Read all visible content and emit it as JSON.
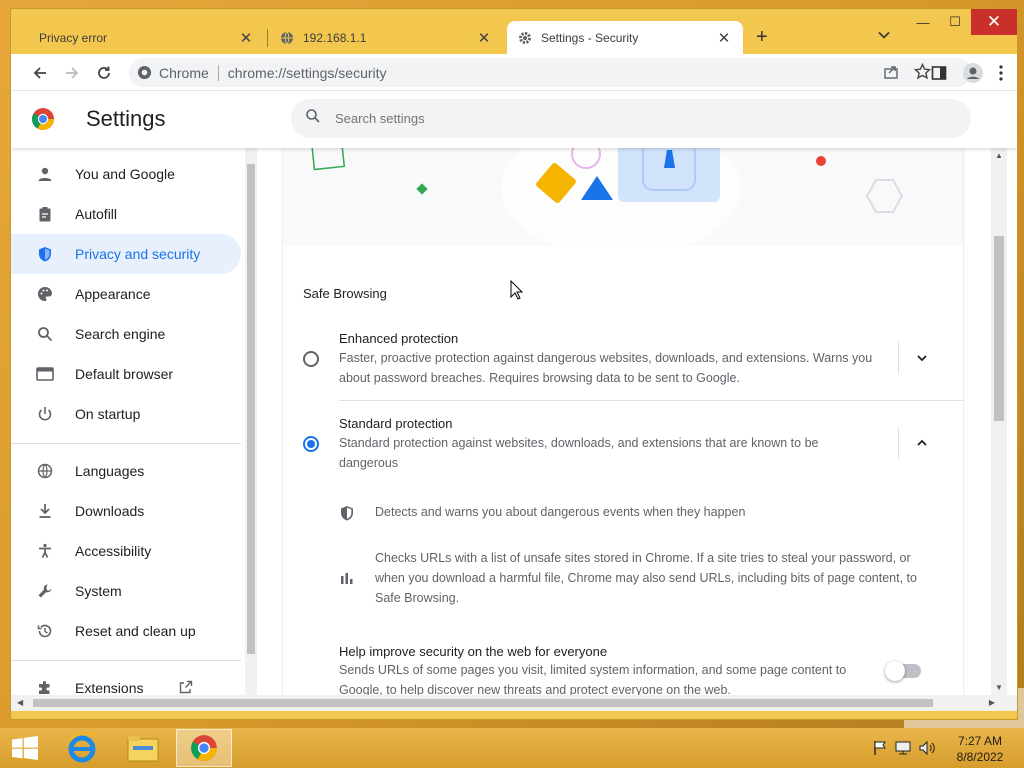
{
  "tabs": [
    {
      "label": "Privacy error",
      "active": false,
      "icon": "none"
    },
    {
      "label": "192.168.1.1",
      "active": false,
      "icon": "globe-icon"
    },
    {
      "label": "Settings - Security",
      "active": true,
      "icon": "gear-icon"
    }
  ],
  "omnibox": {
    "origin_label": "Chrome",
    "url": "chrome://settings/security"
  },
  "settings": {
    "title": "Settings",
    "search_placeholder": "Search settings"
  },
  "sidebar": {
    "items": [
      {
        "label": "You and Google",
        "icon": "person-icon"
      },
      {
        "label": "Autofill",
        "icon": "clipboard-icon"
      },
      {
        "label": "Privacy and security",
        "icon": "shield-icon",
        "active": true
      },
      {
        "label": "Appearance",
        "icon": "palette-icon"
      },
      {
        "label": "Search engine",
        "icon": "search-icon"
      },
      {
        "label": "Default browser",
        "icon": "browser-icon"
      },
      {
        "label": "On startup",
        "icon": "power-icon"
      },
      {
        "label": "Languages",
        "icon": "globe-icon"
      },
      {
        "label": "Downloads",
        "icon": "download-icon"
      },
      {
        "label": "Accessibility",
        "icon": "accessibility-icon"
      },
      {
        "label": "System",
        "icon": "wrench-icon"
      },
      {
        "label": "Reset and clean up",
        "icon": "history-icon"
      },
      {
        "label": "Extensions",
        "icon": "puzzle-icon"
      }
    ]
  },
  "security": {
    "section_title": "Safe Browsing",
    "enhanced": {
      "title": "Enhanced protection",
      "description": "Faster, proactive protection against dangerous websites, downloads, and extensions. Warns you about password breaches. Requires browsing data to be sent to Google."
    },
    "standard": {
      "title": "Standard protection",
      "description": "Standard protection against websites, downloads, and extensions that are known to be dangerous",
      "bullets": [
        "Detects and warns you about dangerous events when they happen",
        "Checks URLs with a list of unsafe sites stored in Chrome. If a site tries to steal your password, or when you download a harmful file, Chrome may also send URLs, including bits of page content, to Safe Browsing."
      ]
    },
    "help_improve": {
      "title": "Help improve security on the web for everyone",
      "description": "Sends URLs of some pages you visit, limited system information, and some page content to Google, to help discover new threats and protect everyone on the web."
    }
  },
  "taskbar": {
    "time": "7:27 AM",
    "date": "8/8/2022"
  },
  "colors": {
    "accent": "#1a73e8",
    "window_frame": "#f3c74d",
    "close_button": "#c9302c"
  }
}
